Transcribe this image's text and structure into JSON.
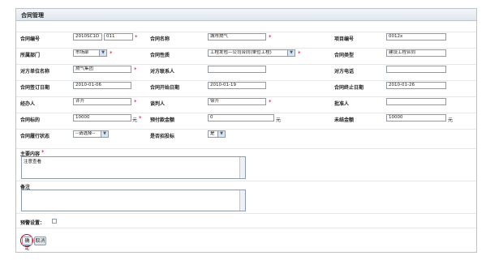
{
  "title": "合同管理",
  "required_mark": "*",
  "fields": {
    "contract_no": {
      "label": "合同编号",
      "value1": "2010SC1D",
      "value2": "011"
    },
    "contract_name": {
      "label": "合同名称",
      "value": "城市燃气"
    },
    "project_no": {
      "label": "项目编号",
      "value": "0012x"
    },
    "department": {
      "label": "所属部门",
      "value": "市场部"
    },
    "contract_nature": {
      "label": "合同性质",
      "value": "工程发包—公司合同(单位工程)"
    },
    "contract_type": {
      "label": "合同类型",
      "value": "建设工程合同"
    },
    "counterparty": {
      "label": "对方单位名称",
      "value": "燃气集团"
    },
    "counterparty_contact": {
      "label": "对方联系人",
      "value": ""
    },
    "counterparty_phone": {
      "label": "对方电话",
      "value": ""
    },
    "sign_date": {
      "label": "合同签订日期",
      "value": "2010-01-06"
    },
    "start_date": {
      "label": "合同开始日期",
      "value": "2010-01-19"
    },
    "end_date": {
      "label": "合同终止日期",
      "value": "2010-01-26"
    },
    "handler": {
      "label": "经办人",
      "value": "许齐"
    },
    "negotiator": {
      "label": "谈判人",
      "value": "徐齐"
    },
    "approver": {
      "label": "批准人",
      "value": ""
    },
    "subject_amount": {
      "label": "合同标的",
      "value": "10000",
      "unit": "元"
    },
    "prepayment": {
      "label": "预付款金额",
      "value": "0",
      "unit": "元"
    },
    "unsettled": {
      "label": "未结金额",
      "value": "10000",
      "unit": "元"
    },
    "fulfillment_status": {
      "label": "合同履行状态",
      "value": "--请选择--"
    },
    "is_tender": {
      "label": "是否招投标",
      "value": "是"
    },
    "main_content": {
      "label": "主要内容",
      "value": "注意查看"
    },
    "remarks": {
      "label": "备注",
      "value": ""
    },
    "warning": {
      "label": "预警设置："
    }
  },
  "buttons": {
    "confirm": "确定",
    "cancel": "取消"
  }
}
